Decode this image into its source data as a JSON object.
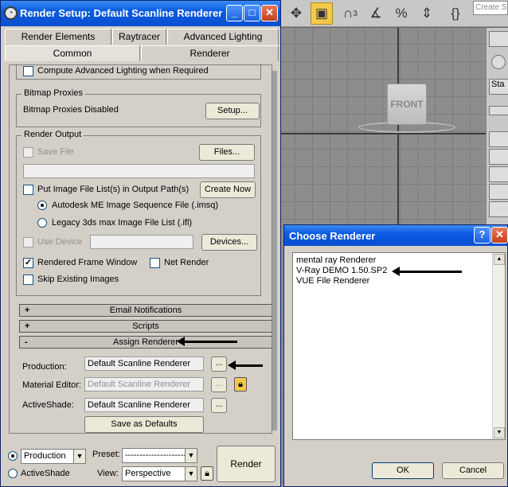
{
  "max_toolbar": {
    "icons": [
      "select-icon",
      "cube-icon",
      "snap-3d-icon",
      "angle-snap-icon",
      "percent-snap-icon",
      "spinner-snap-icon",
      "named-selection-icon"
    ],
    "snap_label": "3",
    "search_placeholder": "Create Se"
  },
  "viewport": {
    "cube_label": "FRONT"
  },
  "command_panel": {
    "label": "Sta"
  },
  "render_setup": {
    "title": "Render Setup: Default Scanline Renderer",
    "tabs_row1": [
      "Render Elements",
      "Raytracer",
      "Advanced Lighting"
    ],
    "tabs_row2": [
      "Common",
      "Renderer"
    ],
    "active_tab": "Common",
    "compute_advanced_lighting": "Compute Advanced Lighting when Required",
    "bitmap_proxies": {
      "group_label": "Bitmap Proxies",
      "status": "Bitmap Proxies Disabled",
      "setup_button": "Setup..."
    },
    "render_output": {
      "group_label": "Render Output",
      "save_file": "Save File",
      "files_button": "Files...",
      "put_image_file_list": "Put Image File List(s) in Output Path(s)",
      "create_now_button": "Create Now",
      "autodesk_me": "Autodesk ME Image Sequence File (.imsq)",
      "legacy_3ds": "Legacy 3ds max Image File List (.ifl)",
      "use_device": "Use Device",
      "devices_button": "Devices...",
      "rendered_frame_window": "Rendered Frame Window",
      "net_render": "Net Render",
      "skip_existing": "Skip Existing Images"
    },
    "rollouts": [
      {
        "sign": "+",
        "label": "Email Notifications"
      },
      {
        "sign": "+",
        "label": "Scripts"
      },
      {
        "sign": "-",
        "label": "Assign Renderer"
      }
    ],
    "assign_renderer": {
      "production_label": "Production:",
      "production_value": "Default Scanline Renderer",
      "material_editor_label": "Material Editor:",
      "material_editor_value": "Default Scanline Renderer",
      "activeshade_label": "ActiveShade:",
      "activeshade_value": "Default Scanline Renderer",
      "browse_button": "...",
      "save_defaults_button": "Save as Defaults"
    },
    "bottom": {
      "mode_production": "Production",
      "mode_activeshade": "ActiveShade",
      "production_dropdown": "Production",
      "preset_label": "Preset:",
      "preset_value": "-------------------------",
      "view_label": "View:",
      "view_value": "Perspective",
      "render_button": "Render"
    }
  },
  "choose_renderer": {
    "title": "Choose Renderer",
    "items": [
      "mental ray Renderer",
      "V-Ray DEMO 1.50.SP2",
      "VUE File Renderer"
    ],
    "ok_button": "OK",
    "cancel_button": "Cancel",
    "help_glyph": "?",
    "close_glyph": "✕"
  }
}
